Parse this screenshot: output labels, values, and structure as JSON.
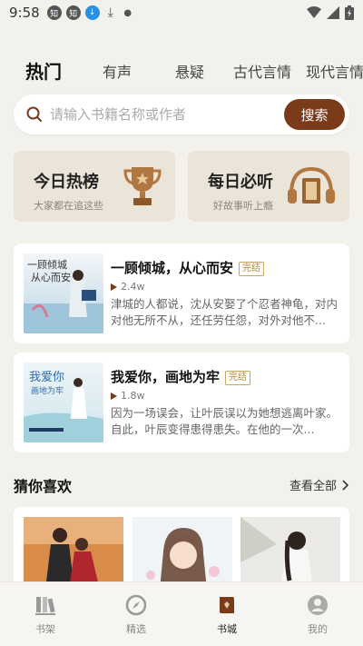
{
  "status": {
    "time": "9:58"
  },
  "tabs": [
    {
      "label": "热门"
    },
    {
      "label": "有声"
    },
    {
      "label": "悬疑"
    },
    {
      "label": "古代言情"
    },
    {
      "label": "现代言情"
    }
  ],
  "search": {
    "placeholder": "请输入书籍名称或作者",
    "button": "搜索"
  },
  "features": [
    {
      "title": "今日热榜",
      "subtitle": "大家都在追这些",
      "icon": "trophy-icon"
    },
    {
      "title": "每日必听",
      "subtitle": "好故事听上瘾",
      "icon": "headphones-icon"
    }
  ],
  "books": [
    {
      "title": "一顾倾城，从心而安",
      "badge": "完结",
      "plays": "2.4w",
      "desc": "津城的人都说，沈从安娶了个忍者神龟，对内对他无所不从，还任劳任怨，对外对他不..."
    },
    {
      "title": "我爱你，画地为牢",
      "badge": "完结",
      "plays": "1.8w",
      "desc": "因为一场误会，让叶辰误以为她想逃离叶家。自此，叶辰变得患得患失。在他的一次..."
    }
  ],
  "section": {
    "title": "猜你喜欢",
    "view_all": "查看全部"
  },
  "nav": [
    {
      "label": "书架",
      "icon": "bookshelf-icon"
    },
    {
      "label": "精选",
      "icon": "compass-icon"
    },
    {
      "label": "书城",
      "icon": "book-store-icon"
    },
    {
      "label": "我的",
      "icon": "profile-icon"
    }
  ],
  "colors": {
    "accent": "#7b3a1a",
    "badge": "#c9a55c",
    "background": "#f3f1ec"
  }
}
